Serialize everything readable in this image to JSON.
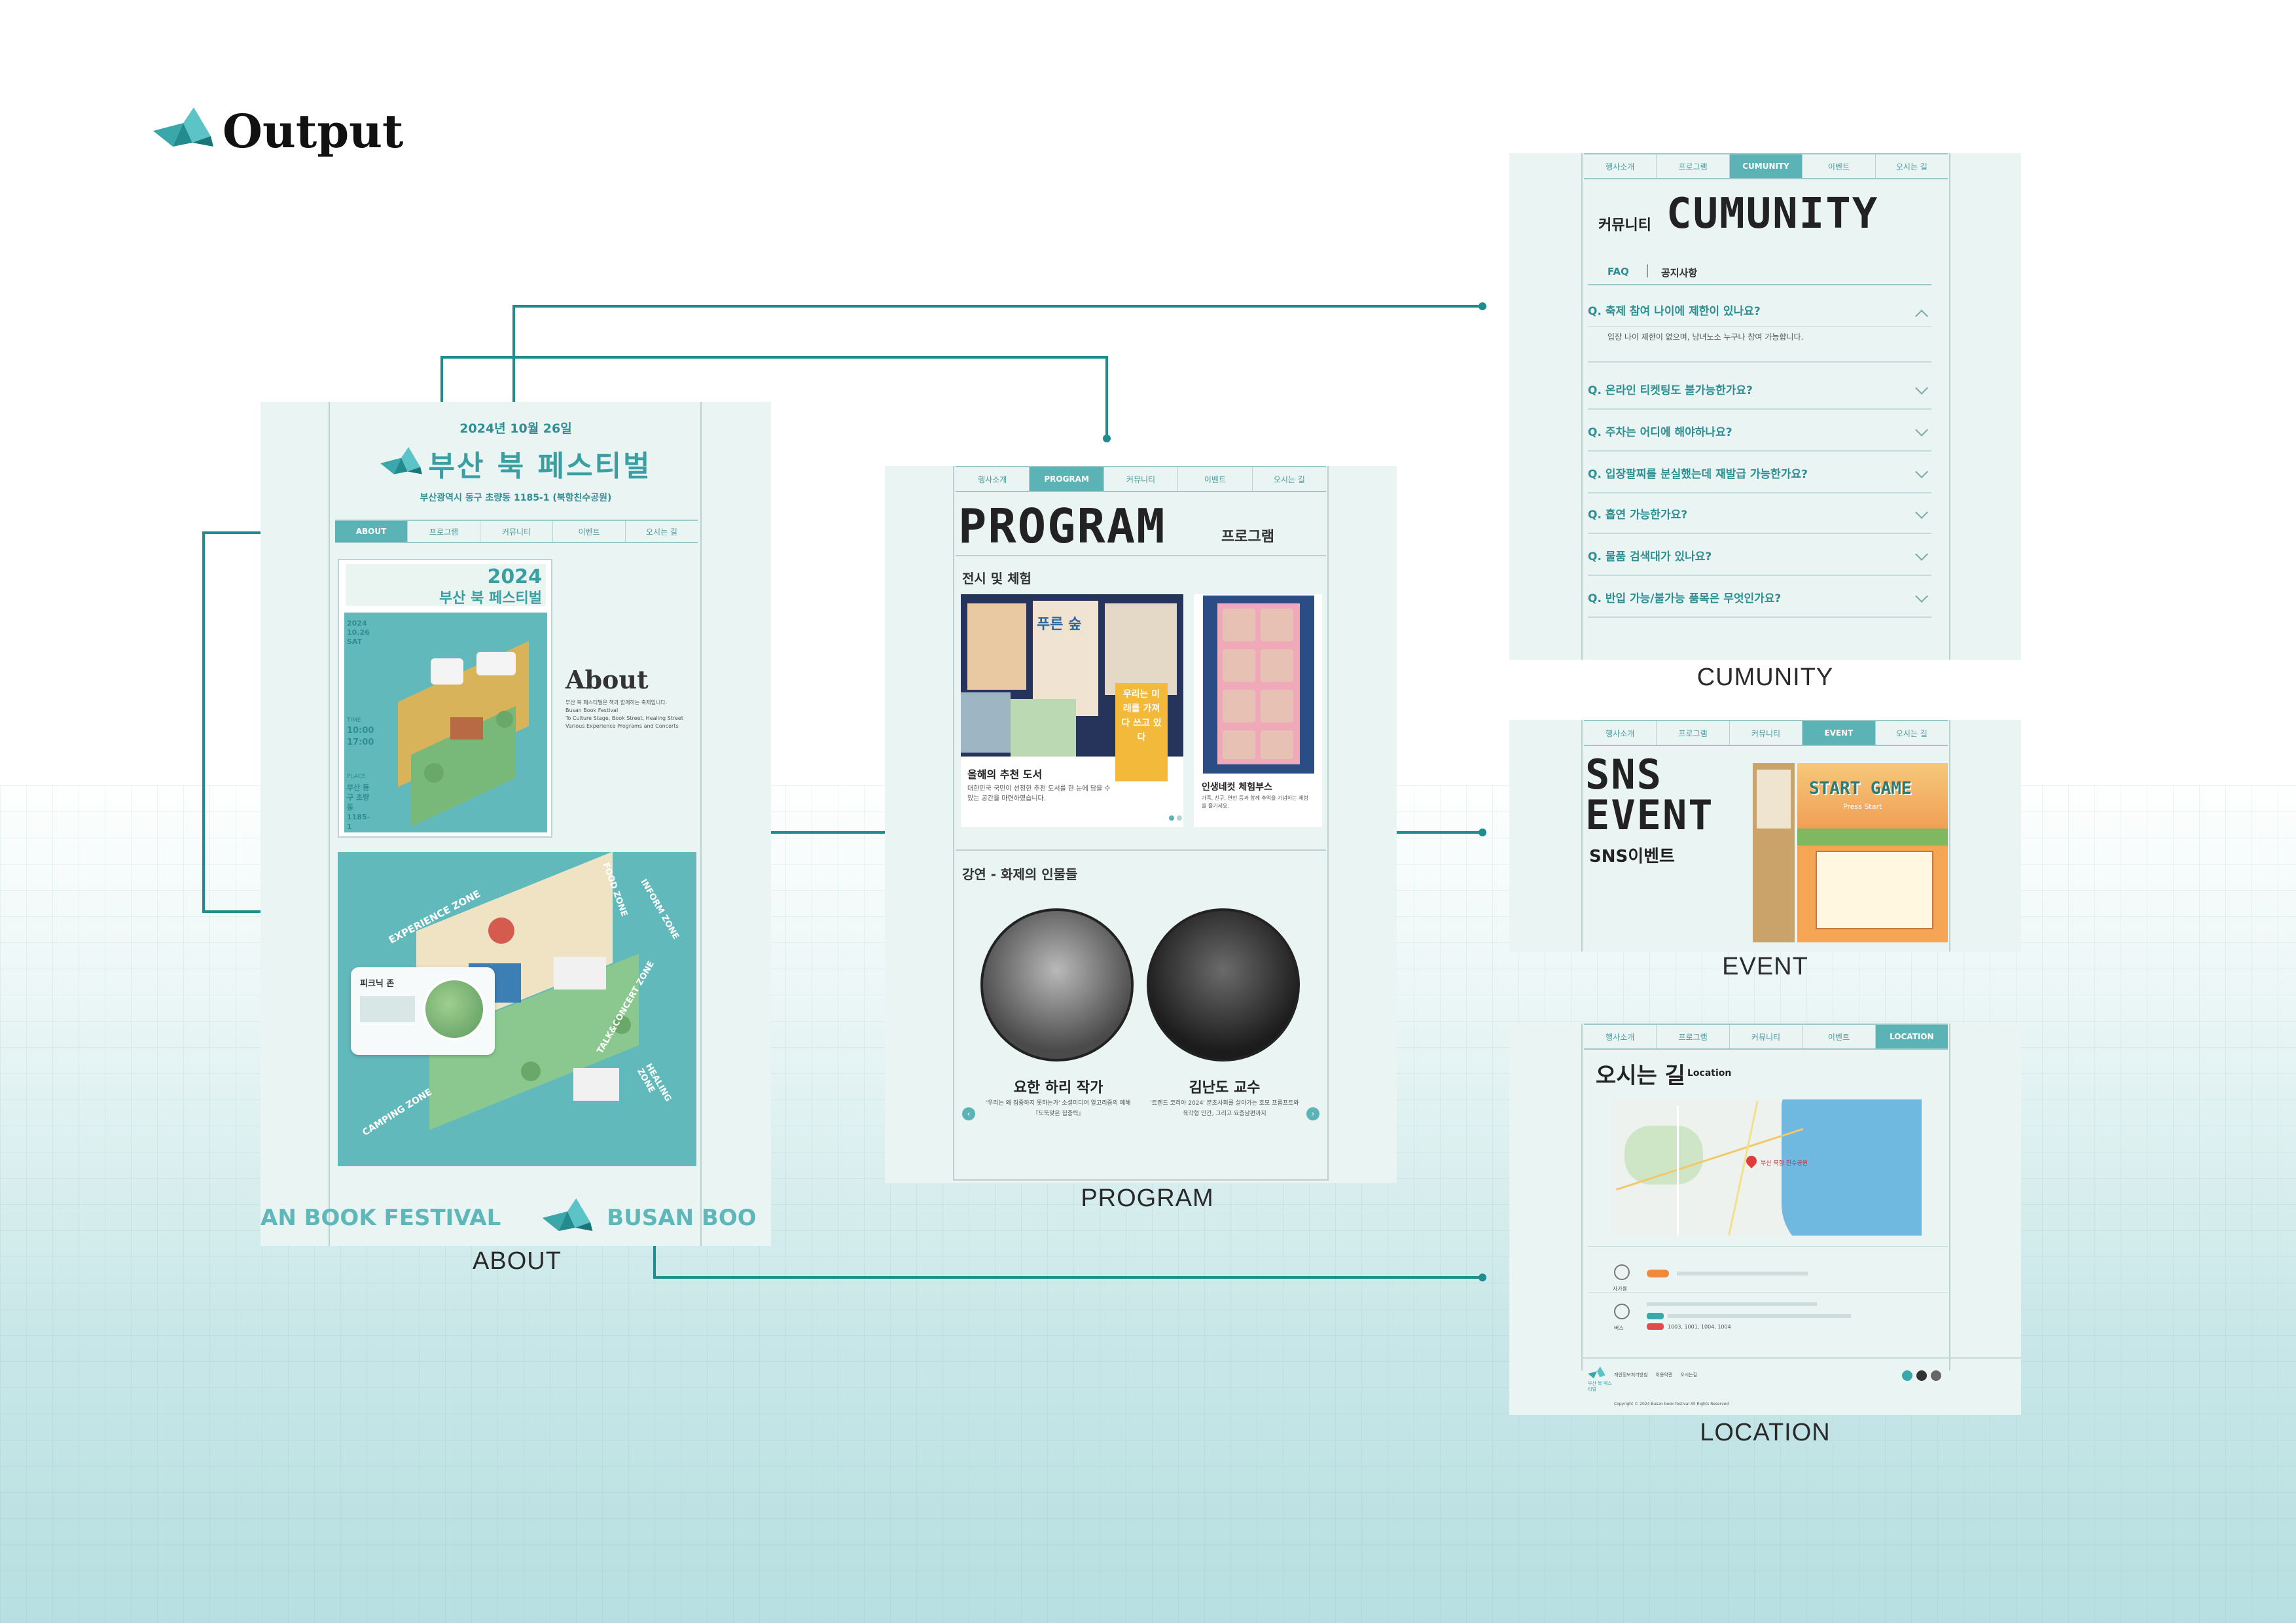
{
  "header": {
    "title": "Output",
    "logo_icon": "bird-logo-icon"
  },
  "nav_tabs": [
    "행사소개",
    "프로그램",
    "커뮤니티",
    "이벤트",
    "오시는 길"
  ],
  "about": {
    "caption": "ABOUT",
    "date": "2024년 10월 26일",
    "title": "부산 북 페스티벌",
    "address": "부산광역시 동구 초량동 1185-1 (북항친수공원)",
    "tabs": [
      "ABOUT",
      "프로그램",
      "커뮤니티",
      "이벤트",
      "오시는 길"
    ],
    "poster_year": "2024",
    "poster_title": "부산 북 페스티벌",
    "poster_date": "2024 10.26 SAT",
    "poster_time_label": "TIME",
    "poster_time": "10:00 17:00",
    "poster_place_label": "PLACE",
    "poster_place": "부산 동구 초량동 1185-1",
    "about_heading": "About",
    "about_text": [
      "부산 북 페스티벌은 책과 함께하는 축제입니다.",
      "Busan Book Festival",
      "To Culture Stage, Book Street, Healing Street",
      "Various Experience Programs and Concerts"
    ],
    "zones": [
      "EXPERIENCE ZONE",
      "FOOD ZONE",
      "INFORM ZONE",
      "TALK&CONCERT ZONE",
      "CAMPING ZONE",
      "HEALING ZONE"
    ],
    "popup_title": "피크닉 존",
    "marquee": [
      "AN BOOK FESTIVAL",
      "BUSAN BOO"
    ]
  },
  "program": {
    "caption": "PROGRAM",
    "tabs": [
      "행사소개",
      "PROGRAM",
      "커뮤니티",
      "이벤트",
      "오시는 길"
    ],
    "title": "PROGRAM",
    "title_kr": "프로그램",
    "section1": "전시 및 체험",
    "card1_title": "올해의 추천 도서",
    "card1_desc": "대한민국 국민이 선정한 추천 도서를 한 눈에 담을 수 있는 공간을 마련하였습니다.",
    "book_title": "우리는 미래를 가져다 쓰고 있다",
    "book2_title": "푸른 숲",
    "card2_title": "인생네컷 체험부스",
    "card2_desc": "가족, 친구, 연인 등과 함께 추억을 기념하는 체험을 즐기세요.",
    "section2": "강연 - 화제의 인물들",
    "speaker1": "요한 하리 작가",
    "speaker1_desc": "'우리는 왜 집중하지 못하는가' 소셜미디어 알고리즘의 폐해 『도둑맞은 집중력』",
    "speaker2": "김난도 교수",
    "speaker2_desc": "'트렌드 코리아 2024' 분초사회를 살아가는 호모 프롬프트와 육각형 인간, 그리고 요즘남편까지"
  },
  "community": {
    "caption": "CUMUNITY",
    "tabs": [
      "행사소개",
      "프로그램",
      "CUMUNITY",
      "이벤트",
      "오시는 길"
    ],
    "title_kr": "커뮤니티",
    "title": "CUMUNITY",
    "subtabs": [
      "FAQ",
      "공지사항"
    ],
    "faq_open": "Q. 축제 참여 나이에 제한이 있나요?",
    "faq_answer": "입장 나이 제한이 없으며, 남녀노소 누구나 참여 가능합니다.",
    "faqs": [
      "Q. 온라인 티켓팅도 불가능한가요?",
      "Q. 주차는 어디에 해야하나요?",
      "Q. 입장팔찌를 분실했는데 재발급 가능한가요?",
      "Q. 흡연 가능한가요?",
      "Q. 물품 검색대가 있나요?",
      "Q. 반입 가능/불가능 품목은 무엇인가요?"
    ]
  },
  "event": {
    "caption": "EVENT",
    "tabs": [
      "행사소개",
      "프로그램",
      "커뮤니티",
      "EVENT",
      "오시는 길"
    ],
    "title_line1": "SNS",
    "title_line2": "EVENT",
    "title_kr": "SNS이벤트",
    "game_title": "START GAME",
    "game_sub": "Press Start"
  },
  "location": {
    "caption": "LOCATION",
    "tabs": [
      "행사소개",
      "프로그램",
      "커뮤니티",
      "이벤트",
      "LOCATION"
    ],
    "title_kr": "오시는 길",
    "title": "Location",
    "pin_label": "부산 북항 친수공원",
    "car_label": "자가용",
    "bus_label": "버스",
    "bus_numbers": "1003, 1001, 1004, 1004",
    "footer_logo": "부산 북 페스티벌",
    "footer_links": [
      "개인정보처리방침",
      "이용약관",
      "오시는길"
    ],
    "copyright": "Copyright © 2024 Busan book festival All Rights Reserved"
  },
  "colors": {
    "accent": "#1f8d8f",
    "tab_active": "#5bb3b6",
    "panel": "#e9f4f3",
    "poster": "#62b9bb"
  }
}
